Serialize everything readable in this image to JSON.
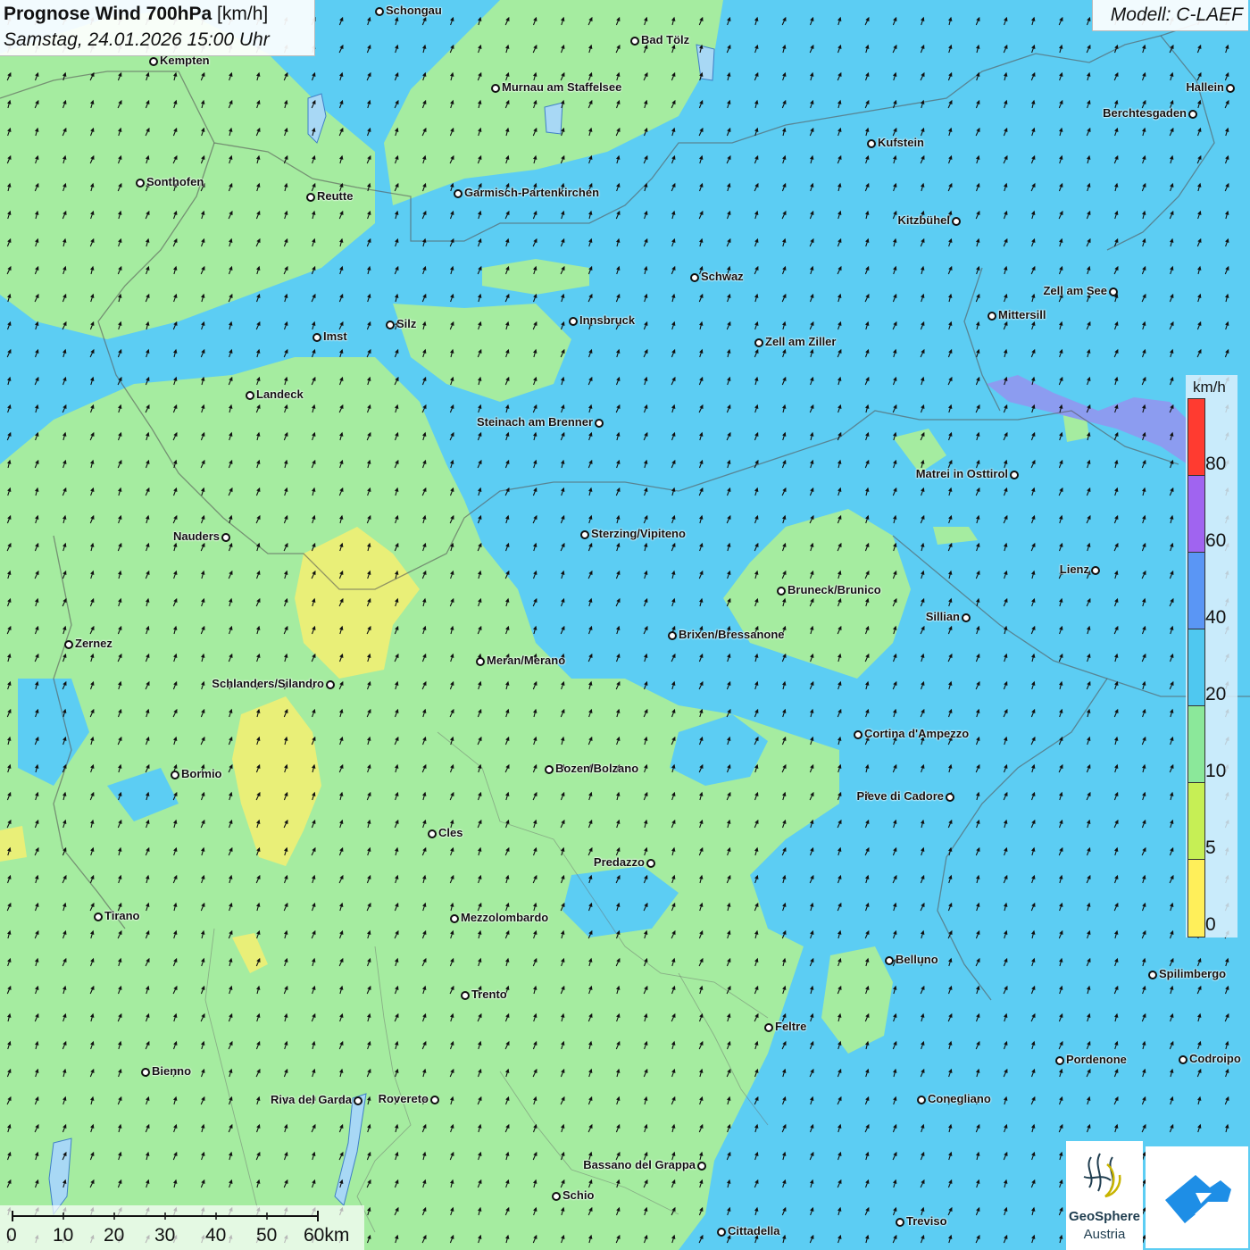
{
  "header": {
    "title_bold": "Prognose Wind 700hPa",
    "title_unit": "[km/h]",
    "datetime": "Samstag, 24.01.2026 15:00 Uhr"
  },
  "model": {
    "label": "Modell: C-LAEF"
  },
  "legend": {
    "unit": "km/h",
    "ticks": [
      "80",
      "60",
      "40",
      "20",
      "10",
      "5",
      "0"
    ],
    "colors": [
      "#ff3b30",
      "#a064f0",
      "#5a96f5",
      "#4fc8f0",
      "#8be89a",
      "#c6ef55",
      "#ffef5a"
    ]
  },
  "scale_bar": {
    "labels": [
      "0",
      "10",
      "20",
      "30",
      "40",
      "50",
      "60km"
    ]
  },
  "logos": {
    "geosphere_name": "GeoSphere",
    "geosphere_sub": "Austria"
  },
  "colors": {
    "field_blue": "#5ccdf3",
    "field_green": "#a5eca0",
    "field_yellow": "#e9ef78",
    "field_purple": "#8c9cf0"
  },
  "wind": {
    "prevailing": "from south-southwest",
    "arrow_color": "#111111"
  },
  "cities": [
    {
      "name": "Schongau"
    },
    {
      "name": "Bad Tölz"
    },
    {
      "name": "Kempten"
    },
    {
      "name": "Murnau am Staffelsee"
    },
    {
      "name": "Hallein"
    },
    {
      "name": "Berchtesgaden"
    },
    {
      "name": "Kufstein"
    },
    {
      "name": "Sonthofen"
    },
    {
      "name": "Reutte"
    },
    {
      "name": "Garmisch-Partenkirchen"
    },
    {
      "name": "Kitzbühel"
    },
    {
      "name": "Schwaz"
    },
    {
      "name": "Zell am See"
    },
    {
      "name": "Mittersill"
    },
    {
      "name": "Innsbruck"
    },
    {
      "name": "Silz"
    },
    {
      "name": "Imst"
    },
    {
      "name": "Zell am Ziller"
    },
    {
      "name": "Landeck"
    },
    {
      "name": "Steinach am Brenner"
    },
    {
      "name": "Matrei in Osttirol"
    },
    {
      "name": "Nauders"
    },
    {
      "name": "Sterzing/Vipiteno"
    },
    {
      "name": "Lienz"
    },
    {
      "name": "Bruneck/Brunico"
    },
    {
      "name": "Sillian"
    },
    {
      "name": "Zernez"
    },
    {
      "name": "Brixen/Bressanone"
    },
    {
      "name": "Meran/Merano"
    },
    {
      "name": "Schlanders/Silandro"
    },
    {
      "name": "Cortina d'Ampezzo"
    },
    {
      "name": "Bozen/Bolzano"
    },
    {
      "name": "Bormio"
    },
    {
      "name": "Pieve di Cadore"
    },
    {
      "name": "Cles"
    },
    {
      "name": "Predazzo"
    },
    {
      "name": "Tirano"
    },
    {
      "name": "Mezzolombardo"
    },
    {
      "name": "Belluno"
    },
    {
      "name": "Spilimbergo"
    },
    {
      "name": "Trento"
    },
    {
      "name": "Feltre"
    },
    {
      "name": "Pordenone"
    },
    {
      "name": "Codroipo"
    },
    {
      "name": "Bienno"
    },
    {
      "name": "Riva del Garda"
    },
    {
      "name": "Rovereto"
    },
    {
      "name": "Conegliano"
    },
    {
      "name": "Bassano del Grappa"
    },
    {
      "name": "Schio"
    },
    {
      "name": "Treviso"
    },
    {
      "name": "Cittadella"
    }
  ]
}
